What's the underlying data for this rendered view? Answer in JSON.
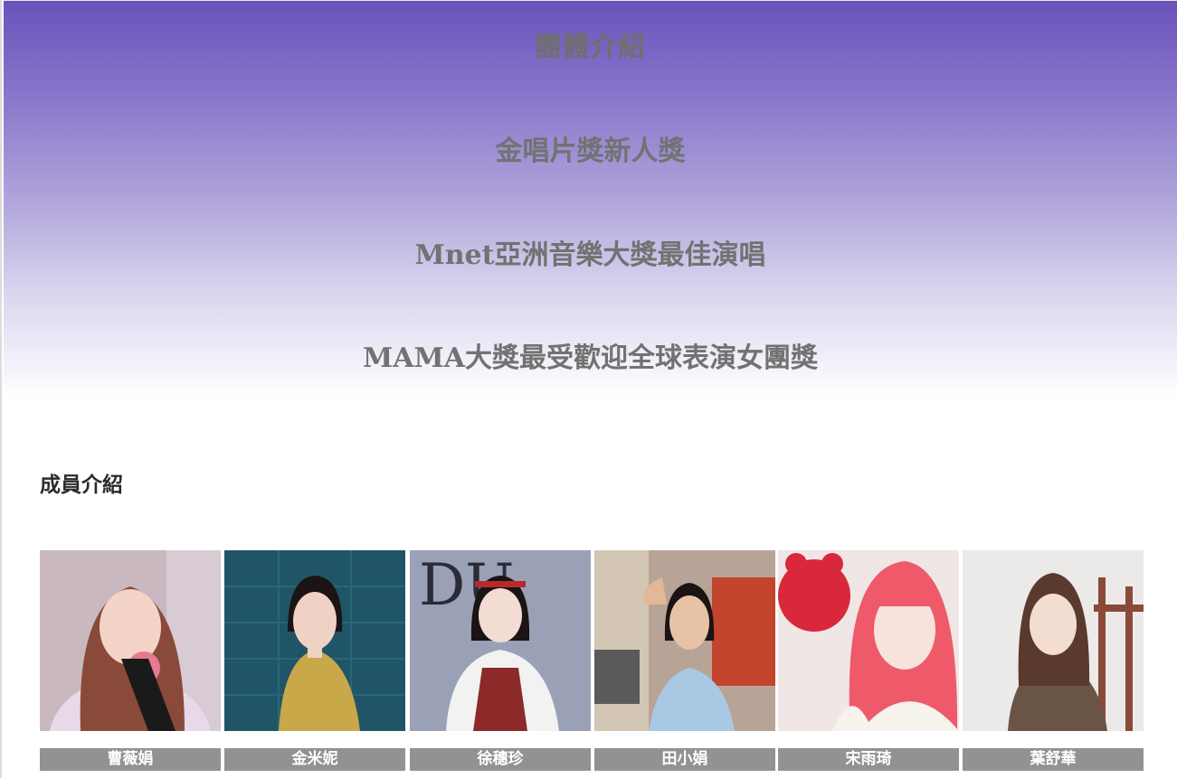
{
  "intro": {
    "title": "團體介紹",
    "awards": [
      "金唱片獎新人獎",
      "Mnet亞洲音樂大獎最佳演唱",
      "MAMA大獎最受歡迎全球表演女團獎"
    ]
  },
  "members_section": {
    "heading": "成員介紹",
    "members": [
      {
        "name": "曹薇娟"
      },
      {
        "name": "金米妮"
      },
      {
        "name": "徐穗珍"
      },
      {
        "name": "田小娟"
      },
      {
        "name": "宋雨琦"
      },
      {
        "name": "葉舒華"
      }
    ]
  },
  "colors": {
    "gradient_top": "#6a52bb",
    "gradient_bottom": "#ffffff",
    "text_gray": "#727272",
    "name_bar": "#929290"
  }
}
